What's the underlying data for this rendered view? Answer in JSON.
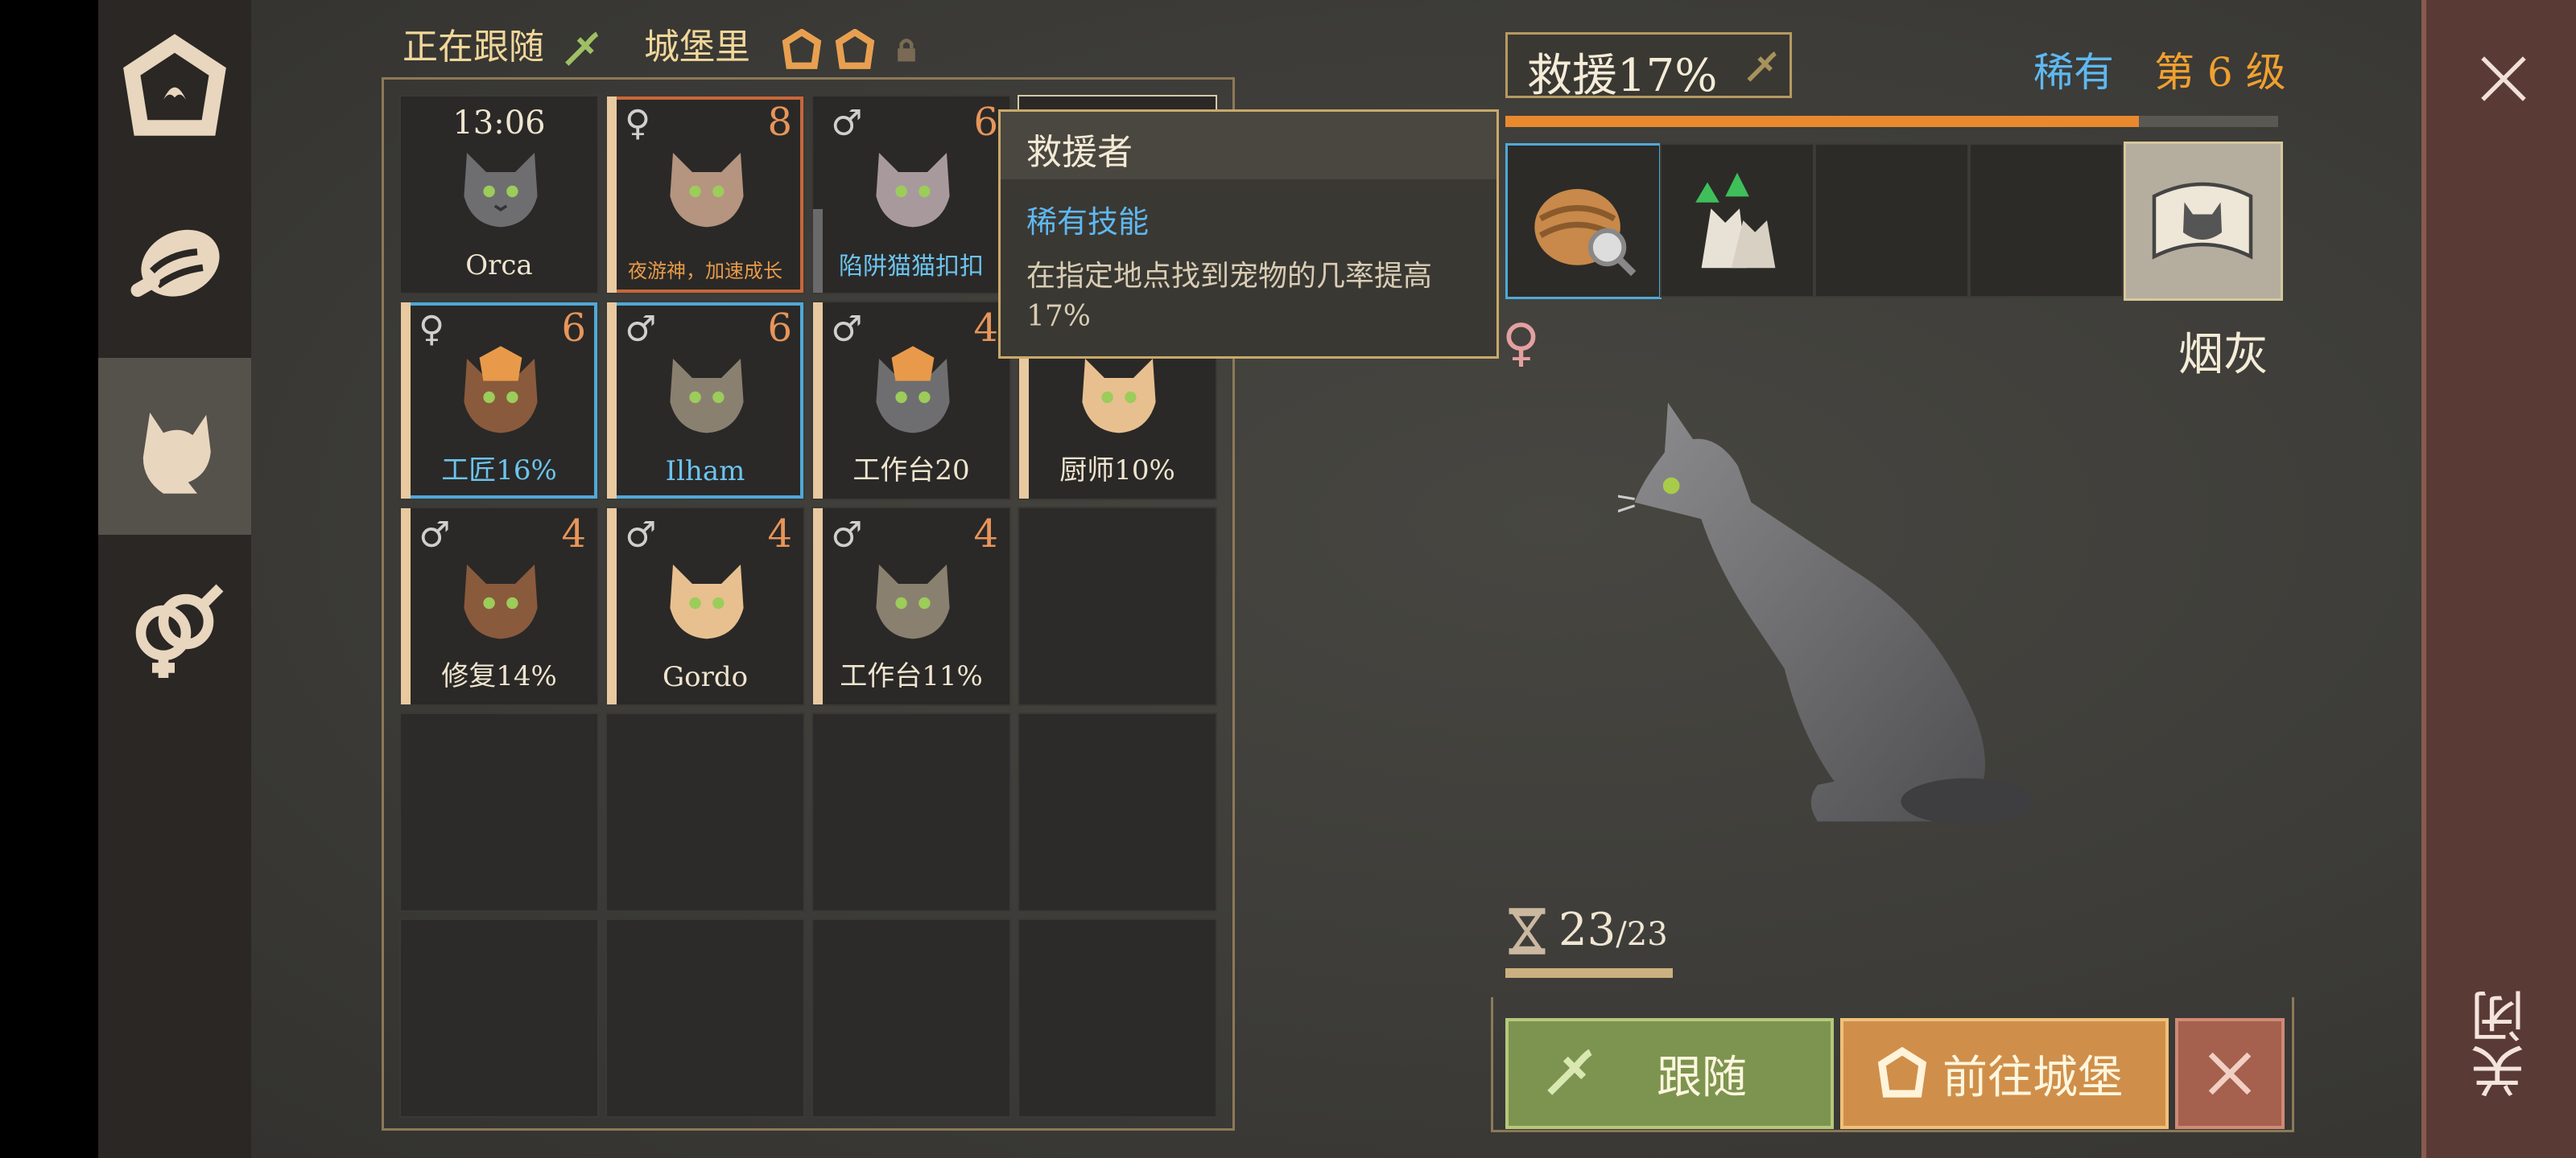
{
  "header": {
    "following_label": "正在跟随",
    "castle_label": "城堡里"
  },
  "pets": [
    {
      "time": "13:06",
      "name": "Orca"
    },
    {
      "level": "8",
      "name": "夜游神，加速成长"
    },
    {
      "level": "6",
      "name": "陷阱猫猫扣扣"
    },
    {
      "level": "6",
      "name": "工匠16%"
    },
    {
      "level": "6",
      "name": "Ilham"
    },
    {
      "level": "4",
      "name": "工作台20"
    },
    {
      "name": "厨师10%"
    },
    {
      "level": "4",
      "name": "修复14%"
    },
    {
      "level": "4",
      "name": "Gordo"
    },
    {
      "level": "4",
      "name": "工作台11%"
    }
  ],
  "tooltip": {
    "title": "救援者",
    "subtitle": "稀有技能",
    "description": "在指定地点找到宠物的几率提高17%"
  },
  "detail": {
    "skill_label": "救援17%",
    "rarity": "稀有",
    "level_label": "第 6 级",
    "progress_fraction": 0.82,
    "pet_name": "烟灰",
    "stamina_current": "23",
    "stamina_max": "/23",
    "stamina_fraction": 1.0
  },
  "buttons": {
    "follow": "跟随",
    "goto_castle": "前往城堡",
    "close_vertical": "关闭"
  },
  "colors": {
    "accent_gold": "#f0d79a",
    "rare_blue": "#5fb8f0",
    "level_orange": "#f0a030",
    "progress_orange": "#e8892e",
    "follow_green": "#8ea653",
    "castle_orange": "#d99a52"
  }
}
